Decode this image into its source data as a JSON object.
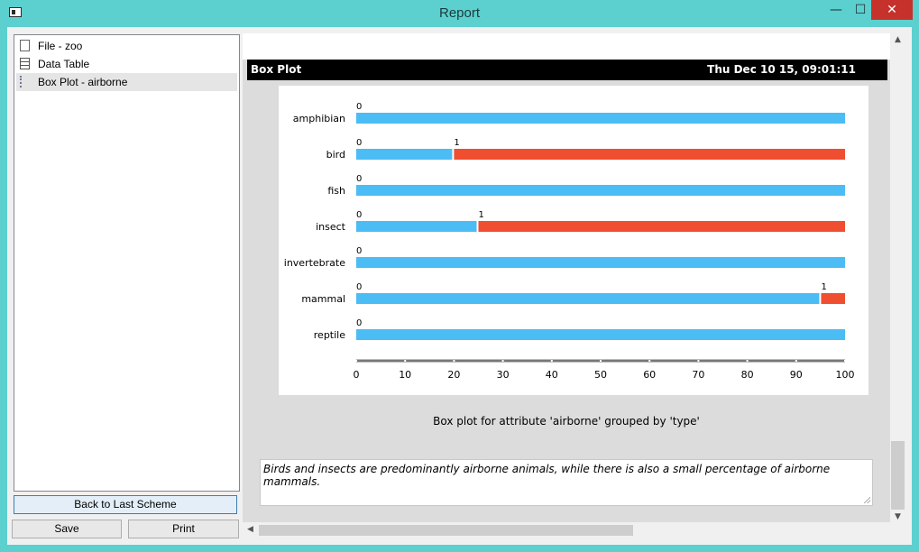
{
  "window": {
    "title": "Report",
    "minimize": "—",
    "maximize": "☐",
    "close": "✕"
  },
  "sidebar": {
    "items": [
      {
        "label": "File - zoo",
        "icon": "file-icon"
      },
      {
        "label": "Data Table",
        "icon": "table-icon"
      },
      {
        "label": "Box Plot - airborne",
        "icon": "boxplot-icon"
      }
    ],
    "selected_index": 2,
    "back_label": "Back to Last Scheme",
    "save_label": "Save",
    "print_label": "Print"
  },
  "report": {
    "section_title": "Box Plot",
    "timestamp": "Thu Dec 10 15, 09:01:11",
    "caption": "Box plot for attribute 'airborne' grouped by 'type'",
    "comment": "Birds and insects are predominantly airborne animals, while there is also a small percentage of airborne mammals."
  },
  "chart_data": {
    "type": "bar",
    "stacked": true,
    "orientation": "horizontal",
    "categories": [
      "amphibian",
      "bird",
      "fish",
      "insect",
      "invertebrate",
      "mammal",
      "reptile"
    ],
    "series": [
      {
        "name": "0",
        "values": [
          100,
          20,
          100,
          25,
          100,
          95.1,
          100
        ]
      },
      {
        "name": "1",
        "values": [
          0,
          80,
          0,
          75,
          0,
          4.9,
          0
        ]
      }
    ],
    "colors": {
      "0": "#4cbcf5",
      "1": "#f04e31"
    },
    "xticks": [
      0,
      10,
      20,
      30,
      40,
      50,
      60,
      70,
      80,
      90,
      100
    ],
    "xlim": [
      0,
      100
    ]
  }
}
